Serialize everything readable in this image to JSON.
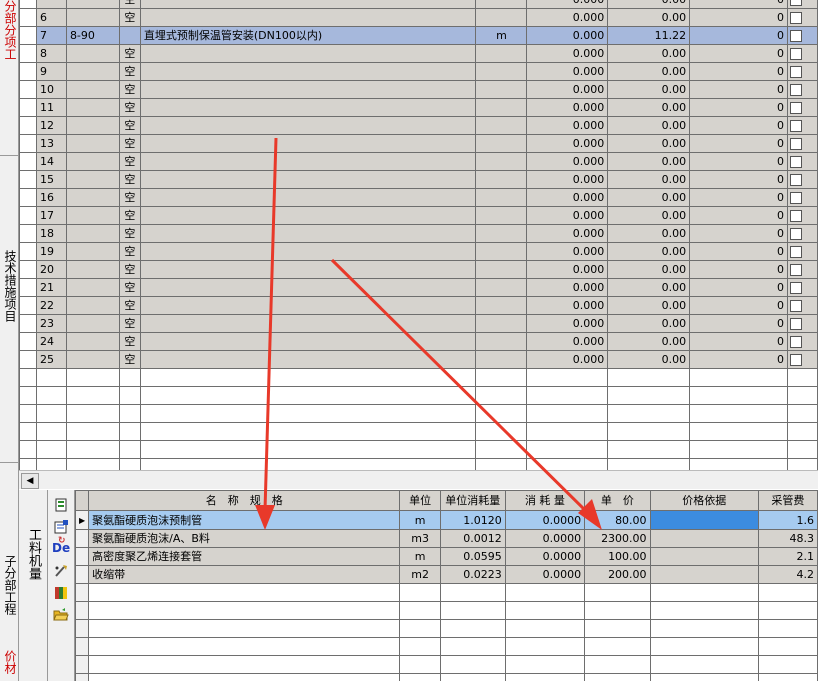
{
  "left_strip": {
    "label_top": "分部分项工",
    "label_middle": "技术措施项目",
    "label_bottom1": "子分部工程",
    "label_bottom2": "价材"
  },
  "top_grid": {
    "rows": [
      {
        "no": "",
        "code": "",
        "type": "空",
        "name": "",
        "unit": "",
        "qty": "0.000",
        "price": "0.00",
        "total": "0",
        "state": "fill",
        "partial": true
      },
      {
        "no": "6",
        "code": "",
        "type": "空",
        "name": "",
        "unit": "",
        "qty": "0.000",
        "price": "0.00",
        "total": "0",
        "state": "fill"
      },
      {
        "no": "7",
        "code": "8-90",
        "type": "",
        "name": "直埋式预制保温管安装(DN100以内)",
        "unit": "m",
        "qty": "0.000",
        "price": "11.22",
        "total": "0",
        "state": "sel"
      },
      {
        "no": "8",
        "code": "",
        "type": "空",
        "name": "",
        "unit": "",
        "qty": "0.000",
        "price": "0.00",
        "total": "0",
        "state": "fill"
      },
      {
        "no": "9",
        "code": "",
        "type": "空",
        "name": "",
        "unit": "",
        "qty": "0.000",
        "price": "0.00",
        "total": "0",
        "state": "fill"
      },
      {
        "no": "10",
        "code": "",
        "type": "空",
        "name": "",
        "unit": "",
        "qty": "0.000",
        "price": "0.00",
        "total": "0",
        "state": "fill"
      },
      {
        "no": "11",
        "code": "",
        "type": "空",
        "name": "",
        "unit": "",
        "qty": "0.000",
        "price": "0.00",
        "total": "0",
        "state": "fill"
      },
      {
        "no": "12",
        "code": "",
        "type": "空",
        "name": "",
        "unit": "",
        "qty": "0.000",
        "price": "0.00",
        "total": "0",
        "state": "fill"
      },
      {
        "no": "13",
        "code": "",
        "type": "空",
        "name": "",
        "unit": "",
        "qty": "0.000",
        "price": "0.00",
        "total": "0",
        "state": "fill"
      },
      {
        "no": "14",
        "code": "",
        "type": "空",
        "name": "",
        "unit": "",
        "qty": "0.000",
        "price": "0.00",
        "total": "0",
        "state": "fill"
      },
      {
        "no": "15",
        "code": "",
        "type": "空",
        "name": "",
        "unit": "",
        "qty": "0.000",
        "price": "0.00",
        "total": "0",
        "state": "fill"
      },
      {
        "no": "16",
        "code": "",
        "type": "空",
        "name": "",
        "unit": "",
        "qty": "0.000",
        "price": "0.00",
        "total": "0",
        "state": "fill"
      },
      {
        "no": "17",
        "code": "",
        "type": "空",
        "name": "",
        "unit": "",
        "qty": "0.000",
        "price": "0.00",
        "total": "0",
        "state": "fill"
      },
      {
        "no": "18",
        "code": "",
        "type": "空",
        "name": "",
        "unit": "",
        "qty": "0.000",
        "price": "0.00",
        "total": "0",
        "state": "fill"
      },
      {
        "no": "19",
        "code": "",
        "type": "空",
        "name": "",
        "unit": "",
        "qty": "0.000",
        "price": "0.00",
        "total": "0",
        "state": "fill"
      },
      {
        "no": "20",
        "code": "",
        "type": "空",
        "name": "",
        "unit": "",
        "qty": "0.000",
        "price": "0.00",
        "total": "0",
        "state": "fill"
      },
      {
        "no": "21",
        "code": "",
        "type": "空",
        "name": "",
        "unit": "",
        "qty": "0.000",
        "price": "0.00",
        "total": "0",
        "state": "fill"
      },
      {
        "no": "22",
        "code": "",
        "type": "空",
        "name": "",
        "unit": "",
        "qty": "0.000",
        "price": "0.00",
        "total": "0",
        "state": "fill"
      },
      {
        "no": "23",
        "code": "",
        "type": "空",
        "name": "",
        "unit": "",
        "qty": "0.000",
        "price": "0.00",
        "total": "0",
        "state": "fill"
      },
      {
        "no": "24",
        "code": "",
        "type": "空",
        "name": "",
        "unit": "",
        "qty": "0.000",
        "price": "0.00",
        "total": "0",
        "state": "fill"
      },
      {
        "no": "25",
        "code": "",
        "type": "空",
        "name": "",
        "unit": "",
        "qty": "0.000",
        "price": "0.00",
        "total": "0",
        "state": "fill"
      }
    ],
    "empty_rows": 6
  },
  "bottom_tabs": {
    "tab1": "工料机量"
  },
  "toolbar_icons": [
    "grid-icon",
    "note-icon",
    "de-icon",
    "tools-icon",
    "book-icon",
    "folder-open-icon"
  ],
  "toolbar_de_label": "De",
  "bottom_grid": {
    "headers": {
      "name": "名　称　规　格",
      "unit": "单位",
      "unit_consumption": "单位消耗量",
      "consumption": "消 耗 量",
      "unit_price": "单　价",
      "price_basis": "价格依据",
      "mgmt_fee": "采管费"
    },
    "rows": [
      {
        "name": "聚氨酯硬质泡沫预制管",
        "unit": "m",
        "unit_consumption": "1.0120",
        "consumption": "0.0000",
        "unit_price": "80.00",
        "price_basis": "",
        "mgmt_fee": "1.6",
        "selected": true
      },
      {
        "name": "聚氨酯硬质泡沫/A、B料",
        "unit": "m3",
        "unit_consumption": "0.0012",
        "consumption": "0.0000",
        "unit_price": "2300.00",
        "price_basis": "",
        "mgmt_fee": "48.3",
        "selected": false
      },
      {
        "name": "高密度聚乙烯连接套管",
        "unit": "m",
        "unit_consumption": "0.0595",
        "consumption": "0.0000",
        "unit_price": "100.00",
        "price_basis": "",
        "mgmt_fee": "2.1",
        "selected": false
      },
      {
        "name": "收缩带",
        "unit": "m2",
        "unit_consumption": "0.0223",
        "consumption": "0.0000",
        "unit_price": "200.00",
        "price_basis": "",
        "mgmt_fee": "4.2",
        "selected": false
      }
    ],
    "empty_rows": 6
  },
  "colors": {
    "row_fill": "#d6d3ce",
    "row_selected": "#a6b8dc",
    "annotation_arrow": "#e8392a",
    "price_basis_selected": "#3c8ce0"
  }
}
